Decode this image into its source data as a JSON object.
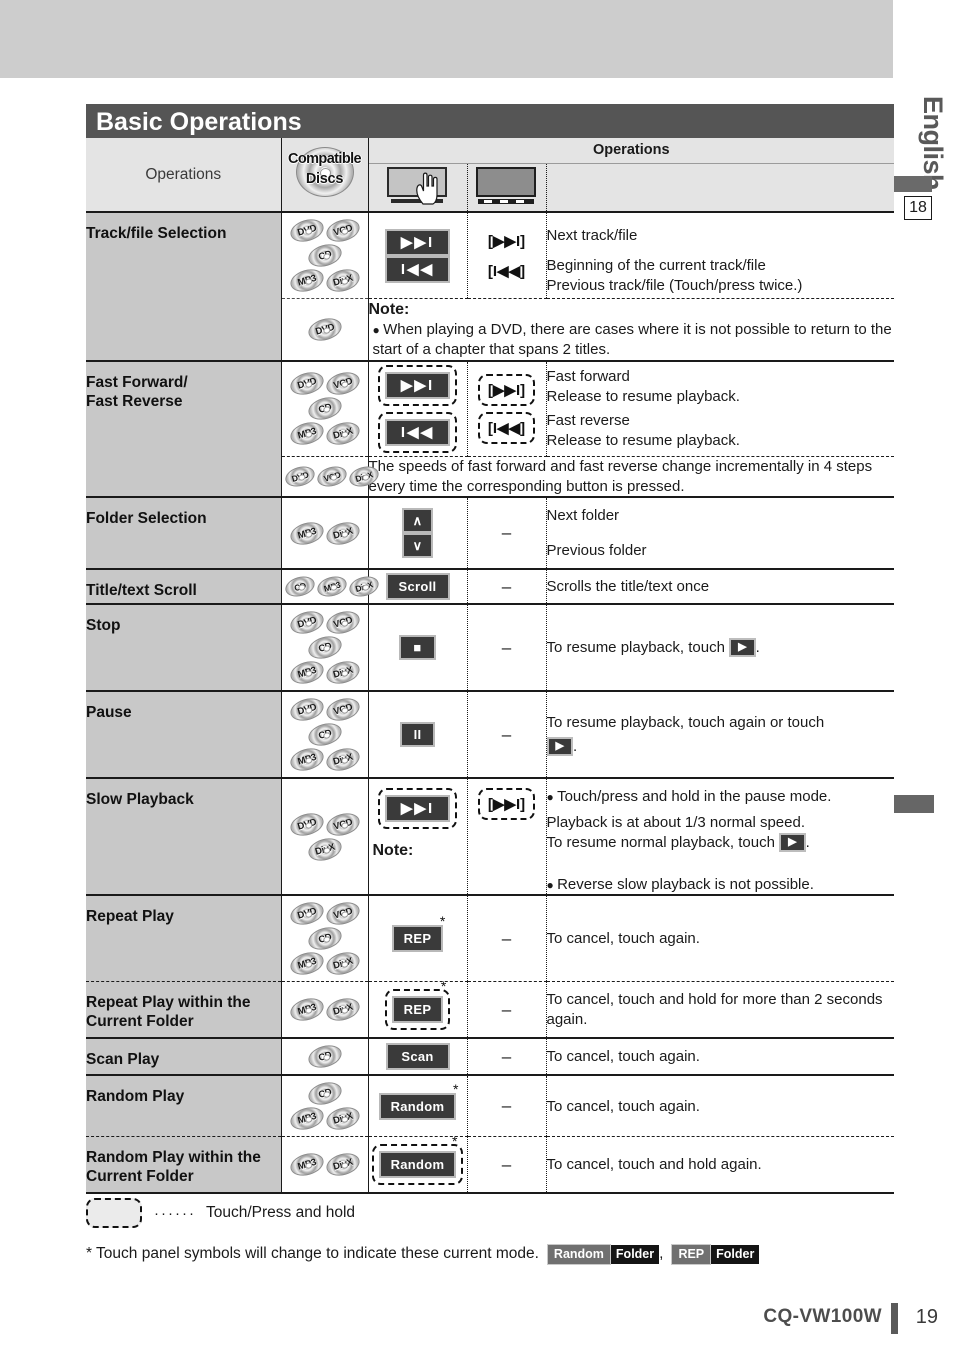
{
  "page": {
    "section_title": "Basic Operations",
    "language_tab": "English",
    "chapter_number": "18",
    "model": "CQ-VW100W",
    "page_number": "19"
  },
  "table": {
    "header": {
      "col_operations": "Operations",
      "col_discs_line1": "Compatible",
      "col_discs_line2": "Discs",
      "col_operations_group": "Operations",
      "icon_touch_panel": "touch-panel-icon",
      "icon_remote_display": "remote-display-icon"
    },
    "rows": [
      {
        "label": "Track/file Selection",
        "discs": [
          "DVD",
          "VCD",
          "CD",
          "MP3",
          "DivX"
        ],
        "panel_keys": [
          "▶▶I",
          "I◀◀"
        ],
        "remote_keys": [
          "[▶▶I]",
          "[I◀◀]"
        ],
        "descriptions": [
          "Next track/file",
          "Beginning of the current track/file\nPrevious track/file (Touch/press twice.)"
        ],
        "note_title": "Note:",
        "note_discs": [
          "DVD"
        ],
        "note_text": "When playing a DVD, there are cases where it is not possible to return to the start of a chapter that spans 2 titles."
      },
      {
        "label": "Fast Forward/\nFast Reverse",
        "discs": [
          "DVD",
          "VCD",
          "CD",
          "MP3",
          "DivX"
        ],
        "panel_keys": [
          "▶▶I",
          "I◀◀"
        ],
        "remote_keys": [
          "[▶▶I]",
          "[I◀◀]"
        ],
        "descriptions": [
          "Fast forward\nRelease to resume playback.",
          "Fast reverse\nRelease to resume playback."
        ],
        "sub_discs": [
          "DVD",
          "VCD",
          "DivX"
        ],
        "sub_text": "The speeds of fast forward and fast reverse change incrementally in 4 steps every time the corresponding button is pressed."
      },
      {
        "label": "Folder Selection",
        "discs": [
          "MP3",
          "DivX"
        ],
        "panel_keys": [
          "∧",
          "∨"
        ],
        "remote_keys": [
          "–"
        ],
        "descriptions": [
          "Next folder",
          "Previous folder"
        ]
      },
      {
        "label": "Title/text Scroll",
        "discs": [
          "CD",
          "MP3",
          "DivX"
        ],
        "panel_keys": [
          "Scroll"
        ],
        "remote_keys": [
          "–"
        ],
        "descriptions": [
          "Scrolls the title/text once"
        ]
      },
      {
        "label": "Stop",
        "discs": [
          "DVD",
          "VCD",
          "CD",
          "MP3",
          "DivX"
        ],
        "panel_keys": [
          "■"
        ],
        "remote_keys": [
          "–"
        ],
        "desc_prefix": "To resume playback, touch ",
        "desc_key": "▶",
        "desc_suffix": "."
      },
      {
        "label": "Pause",
        "discs": [
          "DVD",
          "VCD",
          "CD",
          "MP3",
          "DivX"
        ],
        "panel_keys": [
          "II"
        ],
        "remote_keys": [
          "–"
        ],
        "desc_prefix": "To resume playback, touch again or touch",
        "desc_key": "▶",
        "desc_suffix": "."
      },
      {
        "label": "Slow Playback",
        "discs": [
          "DVD",
          "VCD",
          "DivX"
        ],
        "panel_keys": [
          "▶▶I"
        ],
        "remote_keys": [
          "[▶▶I]"
        ],
        "desc_bullet": "Touch/press and hold in the pause mode.",
        "desc_line2": "Playback is at about 1/3 normal speed.",
        "desc_line3_prefix": "To resume normal playback, touch ",
        "desc_key": "▶",
        "desc_line3_suffix": ".",
        "note_title": "Note:",
        "note_text": "Reverse slow playback is not possible."
      },
      {
        "label": "Repeat Play",
        "discs": [
          "DVD",
          "VCD",
          "CD",
          "MP3",
          "DivX"
        ],
        "panel_keys": [
          "REP"
        ],
        "has_star": true,
        "remote_keys": [
          "–"
        ],
        "descriptions": [
          "To cancel, touch again."
        ]
      },
      {
        "label": "Repeat Play within the\nCurrent Folder",
        "discs": [
          "MP3",
          "DivX"
        ],
        "panel_keys": [
          "REP"
        ],
        "has_star": true,
        "hold": true,
        "remote_keys": [
          "–"
        ],
        "descriptions": [
          "To cancel, touch and hold for more than 2 seconds again."
        ]
      },
      {
        "label": "Scan Play",
        "discs": [
          "CD"
        ],
        "panel_keys": [
          "Scan"
        ],
        "remote_keys": [
          "–"
        ],
        "descriptions": [
          "To cancel, touch again."
        ]
      },
      {
        "label": "Random Play",
        "discs": [
          "CD",
          "MP3",
          "DivX"
        ],
        "panel_keys": [
          "Random"
        ],
        "has_star": true,
        "remote_keys": [
          "–"
        ],
        "descriptions": [
          "To cancel, touch again."
        ]
      },
      {
        "label": "Random Play within the\nCurrent Folder",
        "discs": [
          "MP3",
          "DivX"
        ],
        "panel_keys": [
          "Random"
        ],
        "has_star": true,
        "hold": true,
        "remote_keys": [
          "–"
        ],
        "descriptions": [
          "To cancel, touch and hold again."
        ]
      }
    ]
  },
  "legend": {
    "dots": "······",
    "hold_text": "Touch/Press and hold",
    "footnote": "* Touch panel symbols will change to indicate these current mode.",
    "badges": [
      {
        "main": "Random",
        "folder": "Folder"
      },
      {
        "main": "REP",
        "folder": "Folder"
      }
    ],
    "badge_separator": ","
  }
}
